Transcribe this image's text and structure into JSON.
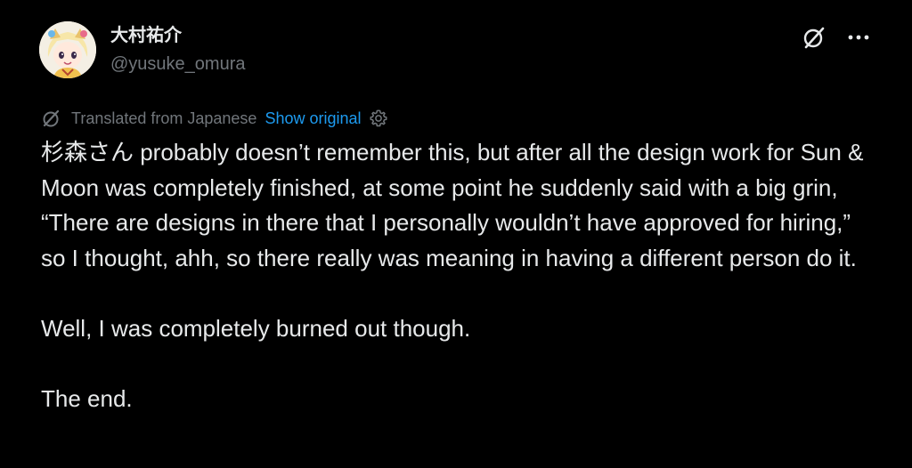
{
  "author": {
    "display_name": "大村祐介",
    "handle": "@yusuke_omura",
    "avatar_icon": "avatar-image"
  },
  "actions": {
    "grok_icon": "grok-icon",
    "more_icon": "more-options-icon"
  },
  "translation": {
    "icon": "translate-icon",
    "label": "Translated from Japanese",
    "show_original": "Show original",
    "settings_icon": "gear-icon"
  },
  "post": {
    "paragraphs": [
      "杉森さん probably doesn’t remember this, but after all the design work for Sun & Moon was completely finished, at some point he suddenly said with a big grin, “There are designs in there that I personally wouldn’t have approved for hiring,” so I thought, ahh, so there really was meaning in having a different person do it.",
      "Well, I was completely burned out though.",
      "The end."
    ]
  },
  "colors": {
    "background": "#000000",
    "text": "#e7e9ea",
    "muted": "#71767b",
    "link": "#1d9bf0"
  }
}
